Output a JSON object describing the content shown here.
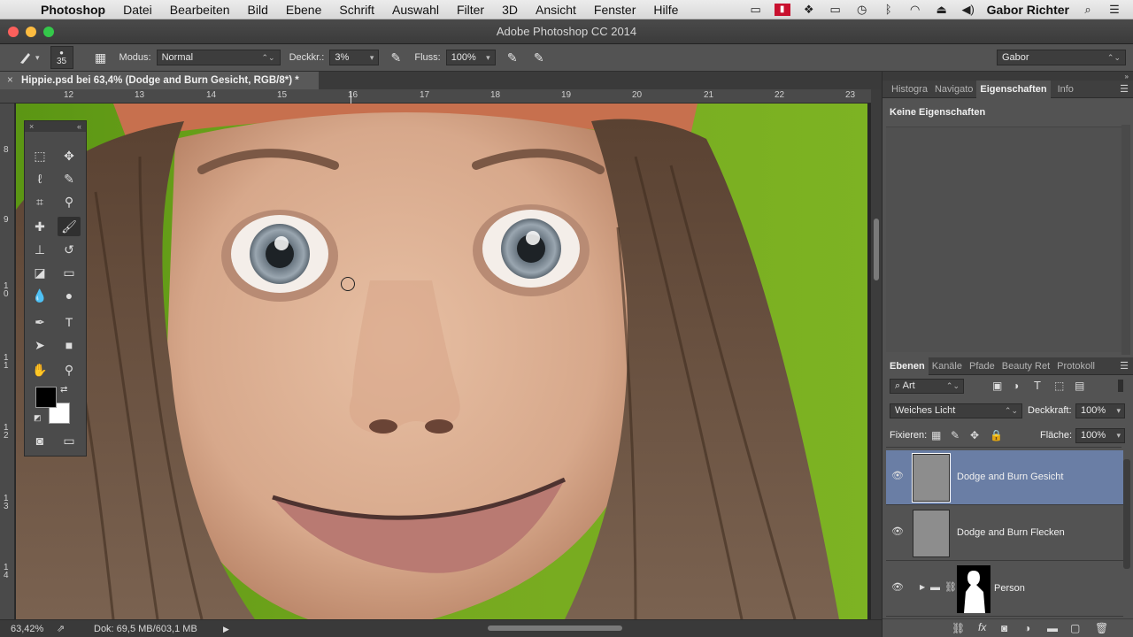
{
  "menubar": {
    "app": "Photoshop",
    "items": [
      "Datei",
      "Bearbeiten",
      "Bild",
      "Ebene",
      "Schrift",
      "Auswahl",
      "Filter",
      "3D",
      "Ansicht",
      "Fenster",
      "Hilfe"
    ],
    "user": "Gabor Richter"
  },
  "window": {
    "title": "Adobe Photoshop CC 2014"
  },
  "options": {
    "brush_size": "35",
    "mode_label": "Modus:",
    "mode_value": "Normal",
    "opacity_label": "Deckkr.:",
    "opacity_value": "3%",
    "flow_label": "Fluss:",
    "flow_value": "100%",
    "workspace": "Gabor"
  },
  "document": {
    "tab_title": "Hippie.psd bei 63,4% (Dodge and Burn Gesicht, RGB/8*) *",
    "zoom": "63,42%",
    "doc_info": "Dok: 69,5 MB/603,1 MB"
  },
  "rulers": {
    "top": [
      "12",
      "13",
      "14",
      "15",
      "16",
      "17",
      "18",
      "19",
      "20",
      "21",
      "22",
      "23"
    ],
    "left": [
      "8",
      "9",
      "1\n0",
      "1\n1",
      "1\n2",
      "1\n3",
      "1\n4"
    ]
  },
  "properties_panel": {
    "tabs": [
      "Histogra",
      "Navigato",
      "Eigenschaften",
      "Info"
    ],
    "content": "Keine Eigenschaften"
  },
  "layers_panel": {
    "tabs": [
      "Ebenen",
      "Kanäle",
      "Pfade",
      "Beauty Ret",
      "Protokoll"
    ],
    "filter_kind": "Art",
    "blend_mode": "Weiches Licht",
    "opacity_label": "Deckkraft:",
    "opacity_value": "100%",
    "lock_label": "Fixieren:",
    "fill_label": "Fläche:",
    "fill_value": "100%",
    "layers": [
      {
        "name": "Dodge and Burn Gesicht",
        "selected": true
      },
      {
        "name": "Dodge and Burn Flecken",
        "selected": false
      },
      {
        "name": "Person",
        "selected": false
      }
    ]
  },
  "colors": {
    "foreground": "#000000",
    "background": "#ffffff",
    "canvas_bg": "#6ea31e",
    "selected_layer": "#6a7ea5"
  }
}
